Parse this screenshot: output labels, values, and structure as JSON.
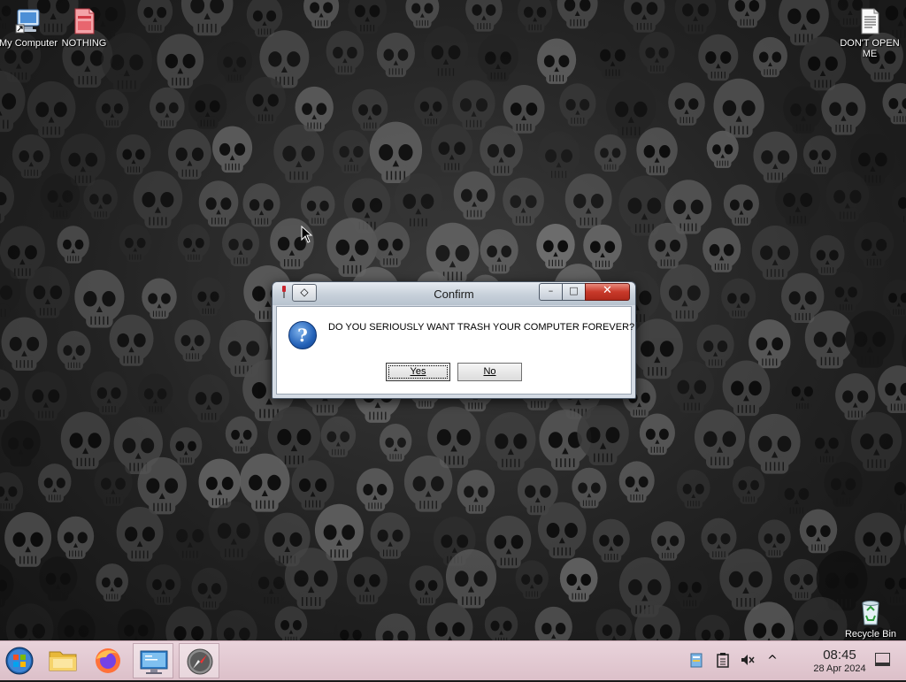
{
  "desktop": {
    "icons": [
      {
        "label": "My Computer",
        "icon": "my-computer-icon"
      },
      {
        "label": "NOTHING",
        "icon": "document-red-icon"
      },
      {
        "label": "DON'T OPEN ME",
        "icon": "text-file-icon"
      },
      {
        "label": "Recycle Bin",
        "icon": "recycle-bin-icon"
      }
    ]
  },
  "dialog": {
    "title": "Confirm",
    "message": "DO YOU SERIOUSLY WANT TRASH YOUR COMPUTER FOREVER?",
    "yes_label": "Yes",
    "no_label": "No",
    "icon": "question-icon",
    "minimize_glyph": "–",
    "maximize_glyph": "□",
    "close_glyph": "✕",
    "menu_glyph": "◇"
  },
  "taskbar": {
    "items": [
      {
        "name": "start-button",
        "icon": "windows-orb-icon"
      },
      {
        "name": "file-explorer",
        "icon": "folder-icon"
      },
      {
        "name": "firefox",
        "icon": "firefox-icon"
      },
      {
        "name": "remote-desktop",
        "icon": "monitor-icon"
      },
      {
        "name": "safari",
        "icon": "compass-icon"
      }
    ],
    "tray": {
      "time": "08:45",
      "date": "28 Apr 2024",
      "caret_glyph": "^"
    }
  },
  "colors": {
    "taskbar": "#e0c7cf",
    "close_button": "#c8392a",
    "dialog_frame": "#d4dbe4"
  }
}
